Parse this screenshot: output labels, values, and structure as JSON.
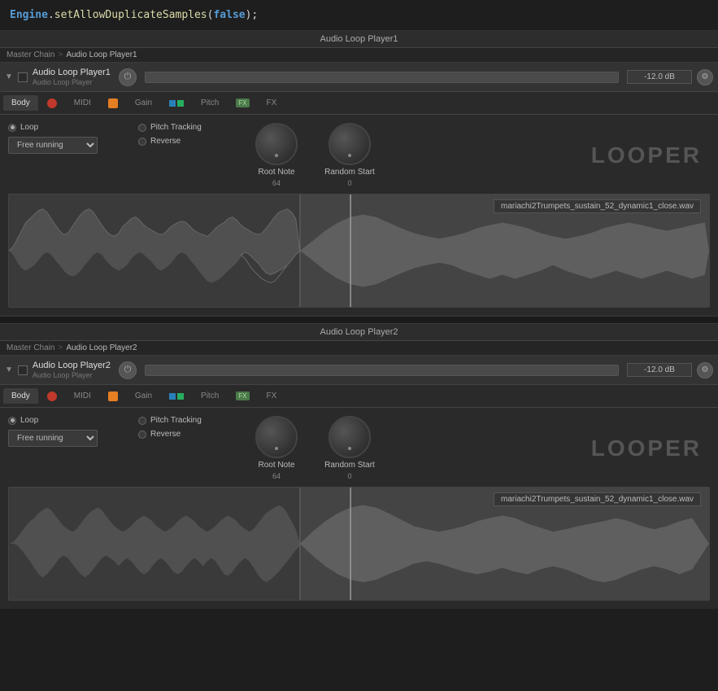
{
  "code": {
    "line": "Engine.setAllowDuplicateSamples(false);"
  },
  "panel1": {
    "title": "Audio Loop Player1",
    "breadcrumb_root": "Master Chain",
    "breadcrumb_sep": ">",
    "breadcrumb_active": "Audio Loop Player1",
    "plugin_name": "Audio Loop Player1",
    "plugin_type": "Audio Loop Player",
    "volume": "-12.0 dB",
    "tabs": {
      "body": "Body",
      "midi": "MIDI",
      "gain": "Gain",
      "pitch": "Pitch",
      "fx1": "FX",
      "fx2": "FX"
    },
    "loop_label": "Loop",
    "pitch_tracking_label": "Pitch Tracking",
    "reverse_label": "Reverse",
    "free_running": "Free running",
    "root_note_label": "Root Note",
    "root_note_value": "64",
    "random_start_label": "Random Start",
    "random_start_value": "0",
    "looper_text": "LOOPER",
    "waveform_file": "mariachi2Trumpets_sustain_52_dynamic1_close.wav"
  },
  "panel2": {
    "title": "Audio Loop Player2",
    "breadcrumb_root": "Master Chain",
    "breadcrumb_sep": ">",
    "breadcrumb_active": "Audio Loop Player2",
    "plugin_name": "Audio Loop Player2",
    "plugin_type": "Audio Loop Player",
    "volume": "-12.0 dB",
    "tabs": {
      "body": "Body",
      "midi": "MIDI",
      "gain": "Gain",
      "pitch": "Pitch",
      "fx1": "FX",
      "fx2": "FX"
    },
    "loop_label": "Loop",
    "pitch_tracking_label": "Pitch Tracking",
    "reverse_label": "Reverse",
    "free_running": "Free running",
    "root_note_label": "Root Note",
    "root_note_value": "64",
    "random_start_label": "Random Start",
    "random_start_value": "0",
    "looper_text": "LOOPER",
    "waveform_file": "mariachi2Trumpets_sustain_52_dynamic1_close.wav"
  },
  "colors": {
    "accent": "#569cd6",
    "bg_dark": "#1e1e1e",
    "bg_panel": "#2a2a2a"
  }
}
